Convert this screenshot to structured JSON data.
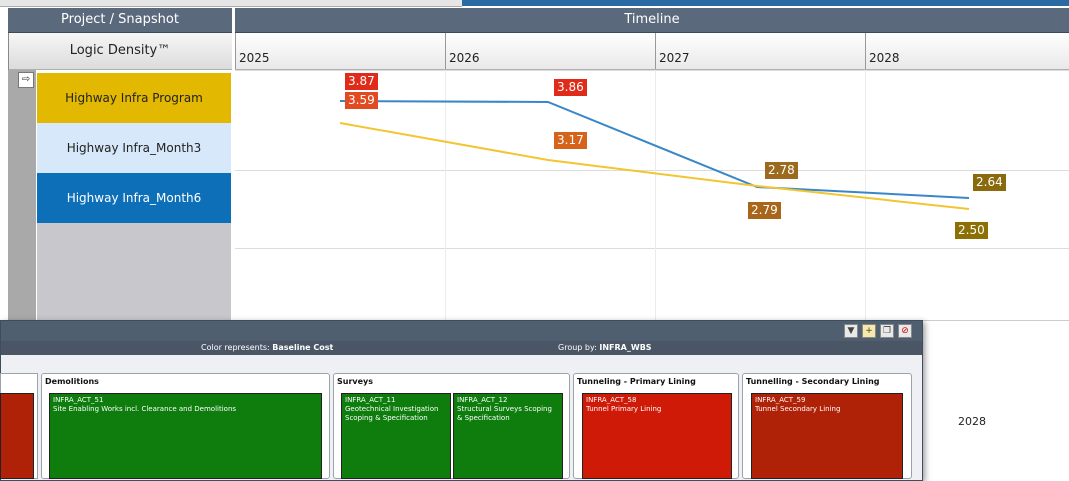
{
  "header": {
    "left_title": "Project / Snapshot",
    "right_title": "Timeline"
  },
  "logic_density_label": "Logic Density™",
  "years": [
    "2025",
    "2026",
    "2027",
    "2028"
  ],
  "rows": [
    {
      "label": "Highway Infra Program",
      "bg": "#e3b800",
      "color": "#222222"
    },
    {
      "label": "Highway Infra_Month3",
      "bg": "#d6e8fa",
      "color": "#222222"
    },
    {
      "label": "Highway Infra_Month6",
      "bg": "#0d6fb8",
      "color": "#ffffff"
    }
  ],
  "chart_data": {
    "type": "line",
    "x": [
      "2025",
      "2026",
      "2027",
      "2028"
    ],
    "series": [
      {
        "color": "#3a87c8",
        "points": [
          {
            "x": 2025.5,
            "y": 3.87
          },
          {
            "x": 2026.5,
            "y": 3.86
          },
          {
            "x": 2027.5,
            "y": 2.78
          },
          {
            "x": 2028.5,
            "y": 2.64
          }
        ]
      },
      {
        "color": "#f2c531",
        "points": [
          {
            "x": 2025.5,
            "y": 3.59
          },
          {
            "x": 2026.5,
            "y": 3.17
          },
          {
            "x": 2027.5,
            "y": 2.79
          },
          {
            "x": 2028.5,
            "y": 2.5
          }
        ]
      }
    ],
    "labels": [
      "3.87",
      "3.59",
      "3.86",
      "3.17",
      "2.78",
      "2.79",
      "2.64",
      "2.50"
    ]
  },
  "lower_year": "2028",
  "popup": {
    "color_represents_label": "Color represents:",
    "color_represents_value": "Baseline Cost",
    "group_by_label": "Group by:",
    "group_by_value": "INFRA_WBS",
    "groups": [
      {
        "title": "Demolitions"
      },
      {
        "title": "Surveys"
      },
      {
        "title": "Tunneling - Primary Lining"
      },
      {
        "title": "Tunnelling - Secondary Lining"
      }
    ],
    "tiles": [
      {
        "id": "INFRA_ACT_51",
        "name": "Site Enabling Works incl. Clearance and Demolitions"
      },
      {
        "id": "INFRA_ACT_11",
        "name": "Geotechnical Investigation Scoping & Specification"
      },
      {
        "id": "INFRA_ACT_12",
        "name": "Structural Surveys Scoping & Specification"
      },
      {
        "id": "INFRA_ACT_58",
        "name": "Tunnel Primary Lining"
      },
      {
        "id": "INFRA_ACT_59",
        "name": "Tunnel Secondary Lining"
      }
    ]
  }
}
